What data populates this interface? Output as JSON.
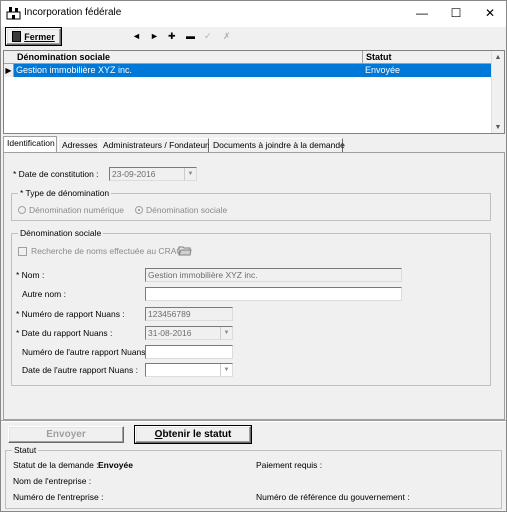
{
  "window": {
    "title": "Incorporation fédérale",
    "minimize": "—",
    "maximize": "☐",
    "close": "✕"
  },
  "toolbar": {
    "close_label_u": "F",
    "close_label_rest": "ermer",
    "icons": [
      "prev-icon",
      "next-icon",
      "add-icon",
      "remove-icon",
      "confirm-icon",
      "cancel-icon"
    ],
    "prev": "◄",
    "next": "►",
    "add": "✚",
    "remove": "▬",
    "confirm": "✓",
    "cancel": "✗"
  },
  "grid": {
    "columns": [
      "Dénomination sociale",
      "Statut"
    ],
    "rows": [
      {
        "denomination": "Gestion immobilière XYZ inc.",
        "statut": "Envoyée",
        "selected": true
      }
    ],
    "row_marker": "▶"
  },
  "tabs": [
    {
      "label": "Identification",
      "active": true
    },
    {
      "label": "Adresses",
      "active": false
    },
    {
      "label": "Administrateurs / Fondateurs",
      "active": false
    },
    {
      "label": "Documents à joindre à la demande",
      "active": false
    }
  ],
  "identification": {
    "date_constitution_label": "* Date de constitution :",
    "date_constitution_value": "23-09-2016",
    "type_denomination": {
      "title": "* Type de dénomination",
      "options": [
        {
          "label": "Dénomination numérique",
          "checked": false
        },
        {
          "label": "Dénomination sociale",
          "checked": true
        }
      ]
    },
    "denomination_sociale": {
      "title": "Dénomination sociale",
      "crac_checkbox": "Recherche de noms effectuée au CRAC",
      "nom_label": "* Nom :",
      "nom_value": "Gestion immobilière XYZ inc.",
      "autre_nom_label": "Autre nom :",
      "autre_nom_value": "",
      "num_rapport_label": "* Numéro de rapport Nuans :",
      "num_rapport_value": "123456789",
      "date_rapport_label": "* Date du rapport Nuans :",
      "date_rapport_value": "31-08-2016",
      "num_autre_rapport_label": "Numéro de l'autre rapport Nuans :",
      "num_autre_rapport_value": "",
      "date_autre_rapport_label": "Date de l'autre rapport Nuans :",
      "date_autre_rapport_value": ""
    }
  },
  "actions": {
    "envoyer": "Envoyer",
    "obtenir_u": "O",
    "obtenir_rest": "btenir le statut"
  },
  "status": {
    "title": "Statut",
    "statut_demande_label": "Statut de la demande :",
    "statut_demande_value": "Envoyée",
    "paiement_label": "Paiement requis :",
    "nom_entreprise_label": "Nom de l'entreprise :",
    "numero_entreprise_label": "Numéro de l'entreprise :",
    "reference_gouv_label": "Numéro de référence du gouvernement :"
  },
  "colors": {
    "selection": "#0078d7",
    "window_bg": "#f0f0f0"
  }
}
